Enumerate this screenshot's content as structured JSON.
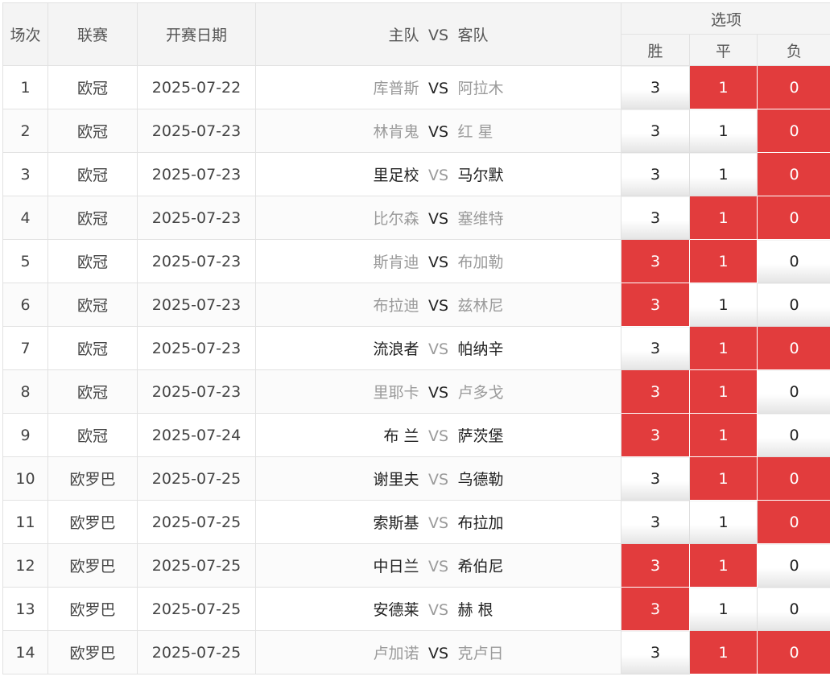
{
  "headers": {
    "index": "场次",
    "league": "联赛",
    "date": "开赛日期",
    "match_home": "主队",
    "match_vs": "VS",
    "match_away": "客队",
    "options": "选项",
    "win": "胜",
    "draw": "平",
    "lose": "负"
  },
  "colors": {
    "selected": "#e23c3d",
    "dim_text": "#9a9a9a",
    "strong_text": "#222222"
  },
  "rows": [
    {
      "index": "1",
      "league": "欧冠",
      "date": "2025-07-22",
      "home": "库普斯",
      "vs": "VS",
      "away": "阿拉木",
      "win": "3",
      "draw": "1",
      "lose": "0",
      "home_strong": false,
      "away_strong": false,
      "vs_strong": true,
      "win_sel": false,
      "draw_sel": true,
      "lose_sel": true
    },
    {
      "index": "2",
      "league": "欧冠",
      "date": "2025-07-23",
      "home": "林肯鬼",
      "vs": "VS",
      "away": "红 星",
      "win": "3",
      "draw": "1",
      "lose": "0",
      "home_strong": false,
      "away_strong": false,
      "vs_strong": true,
      "win_sel": false,
      "draw_sel": false,
      "lose_sel": true
    },
    {
      "index": "3",
      "league": "欧冠",
      "date": "2025-07-23",
      "home": "里足校",
      "vs": "VS",
      "away": "马尔默",
      "win": "3",
      "draw": "1",
      "lose": "0",
      "home_strong": true,
      "away_strong": true,
      "vs_strong": false,
      "win_sel": false,
      "draw_sel": false,
      "lose_sel": true
    },
    {
      "index": "4",
      "league": "欧冠",
      "date": "2025-07-23",
      "home": "比尔森",
      "vs": "VS",
      "away": "塞维特",
      "win": "3",
      "draw": "1",
      "lose": "0",
      "home_strong": false,
      "away_strong": false,
      "vs_strong": true,
      "win_sel": false,
      "draw_sel": true,
      "lose_sel": true
    },
    {
      "index": "5",
      "league": "欧冠",
      "date": "2025-07-23",
      "home": "斯肯迪",
      "vs": "VS",
      "away": "布加勒",
      "win": "3",
      "draw": "1",
      "lose": "0",
      "home_strong": false,
      "away_strong": false,
      "vs_strong": true,
      "win_sel": true,
      "draw_sel": true,
      "lose_sel": false
    },
    {
      "index": "6",
      "league": "欧冠",
      "date": "2025-07-23",
      "home": "布拉迪",
      "vs": "VS",
      "away": "兹林尼",
      "win": "3",
      "draw": "1",
      "lose": "0",
      "home_strong": false,
      "away_strong": false,
      "vs_strong": true,
      "win_sel": true,
      "draw_sel": false,
      "lose_sel": false
    },
    {
      "index": "7",
      "league": "欧冠",
      "date": "2025-07-23",
      "home": "流浪者",
      "vs": "VS",
      "away": "帕纳辛",
      "win": "3",
      "draw": "1",
      "lose": "0",
      "home_strong": true,
      "away_strong": true,
      "vs_strong": false,
      "win_sel": false,
      "draw_sel": true,
      "lose_sel": true
    },
    {
      "index": "8",
      "league": "欧冠",
      "date": "2025-07-23",
      "home": "里耶卡",
      "vs": "VS",
      "away": "卢多戈",
      "win": "3",
      "draw": "1",
      "lose": "0",
      "home_strong": false,
      "away_strong": false,
      "vs_strong": true,
      "win_sel": true,
      "draw_sel": true,
      "lose_sel": false
    },
    {
      "index": "9",
      "league": "欧冠",
      "date": "2025-07-24",
      "home": "布 兰",
      "vs": "VS",
      "away": "萨茨堡",
      "win": "3",
      "draw": "1",
      "lose": "0",
      "home_strong": true,
      "away_strong": true,
      "vs_strong": false,
      "win_sel": true,
      "draw_sel": true,
      "lose_sel": false
    },
    {
      "index": "10",
      "league": "欧罗巴",
      "date": "2025-07-25",
      "home": "谢里夫",
      "vs": "VS",
      "away": "乌德勒",
      "win": "3",
      "draw": "1",
      "lose": "0",
      "home_strong": true,
      "away_strong": true,
      "vs_strong": false,
      "win_sel": false,
      "draw_sel": true,
      "lose_sel": true
    },
    {
      "index": "11",
      "league": "欧罗巴",
      "date": "2025-07-25",
      "home": "索斯基",
      "vs": "VS",
      "away": "布拉加",
      "win": "3",
      "draw": "1",
      "lose": "0",
      "home_strong": true,
      "away_strong": true,
      "vs_strong": false,
      "win_sel": false,
      "draw_sel": false,
      "lose_sel": true
    },
    {
      "index": "12",
      "league": "欧罗巴",
      "date": "2025-07-25",
      "home": "中日兰",
      "vs": "VS",
      "away": "希伯尼",
      "win": "3",
      "draw": "1",
      "lose": "0",
      "home_strong": true,
      "away_strong": true,
      "vs_strong": false,
      "win_sel": true,
      "draw_sel": true,
      "lose_sel": false
    },
    {
      "index": "13",
      "league": "欧罗巴",
      "date": "2025-07-25",
      "home": "安德莱",
      "vs": "VS",
      "away": "赫 根",
      "win": "3",
      "draw": "1",
      "lose": "0",
      "home_strong": true,
      "away_strong": true,
      "vs_strong": false,
      "win_sel": true,
      "draw_sel": false,
      "lose_sel": false
    },
    {
      "index": "14",
      "league": "欧罗巴",
      "date": "2025-07-25",
      "home": "卢加诺",
      "vs": "VS",
      "away": "克卢日",
      "win": "3",
      "draw": "1",
      "lose": "0",
      "home_strong": false,
      "away_strong": false,
      "vs_strong": true,
      "win_sel": false,
      "draw_sel": true,
      "lose_sel": true
    }
  ]
}
